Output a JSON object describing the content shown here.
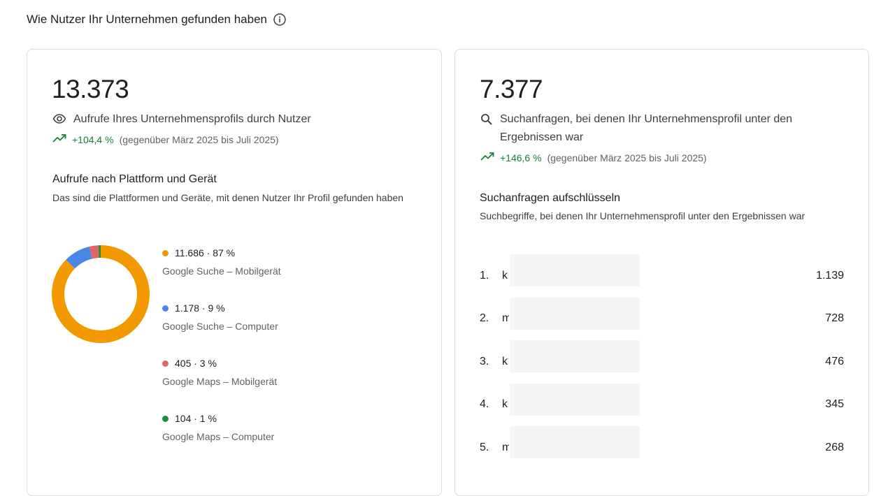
{
  "header": {
    "title": "Wie Nutzer Ihr Unternehmen gefunden haben",
    "info_icon": "info-icon"
  },
  "views_card": {
    "total": "13.373",
    "metric_icon": "eye-icon",
    "metric_label": "Aufrufe Ihres Unternehmensprofils durch Nutzer",
    "trend_icon": "trending-up-icon",
    "trend_value": "+104,4 %",
    "trend_period": "(gegenüber März 2025 bis Juli 2025)",
    "section_title": "Aufrufe nach Plattform und Gerät",
    "section_subtitle": "Das sind die Plattformen und Geräte, mit denen Nutzer Ihr Profil gefunden haben",
    "legend": [
      {
        "value": "11.686 · 87 %",
        "label": "Google Suche – Mobilgerät",
        "color": "#F29900"
      },
      {
        "value": "1.178 · 9 %",
        "label": "Google Suche – Computer",
        "color": "#4A86E8"
      },
      {
        "value": "405 · 3 %",
        "label": "Google Maps – Mobilgerät",
        "color": "#E06666"
      },
      {
        "value": "104 · 1 %",
        "label": "Google Maps – Computer",
        "color": "#1E8E3E"
      }
    ]
  },
  "chart_data": {
    "type": "pie",
    "categories": [
      "Google Suche – Mobilgerät",
      "Google Suche – Computer",
      "Google Maps – Mobilgerät",
      "Google Maps – Computer"
    ],
    "values": [
      11686,
      1178,
      405,
      104
    ],
    "colors": [
      "#F29900",
      "#4A86E8",
      "#E06666",
      "#1E8E3E"
    ],
    "legend": "right"
  },
  "search_card": {
    "total": "7.377",
    "metric_icon": "search-icon",
    "metric_label": "Suchanfragen, bei denen Ihr Unternehmensprofil unter den Ergebnissen war",
    "trend_icon": "trending-up-icon",
    "trend_value": "+146,6 %",
    "trend_period": "(gegenüber März 2025 bis Juli 2025)",
    "section_title": "Suchanfragen aufschlüsseln",
    "section_subtitle": "Suchbegriffe, bei denen Ihr Unternehmensprofil unter den Ergebnissen war",
    "queries": [
      {
        "rank": "1.",
        "text": "k",
        "count": "1.139"
      },
      {
        "rank": "2.",
        "text": "m",
        "count": "728"
      },
      {
        "rank": "3.",
        "text": "k",
        "count": "476"
      },
      {
        "rank": "4.",
        "text": "k",
        "count": "345"
      },
      {
        "rank": "5.",
        "text": "m",
        "count": "268"
      }
    ]
  }
}
